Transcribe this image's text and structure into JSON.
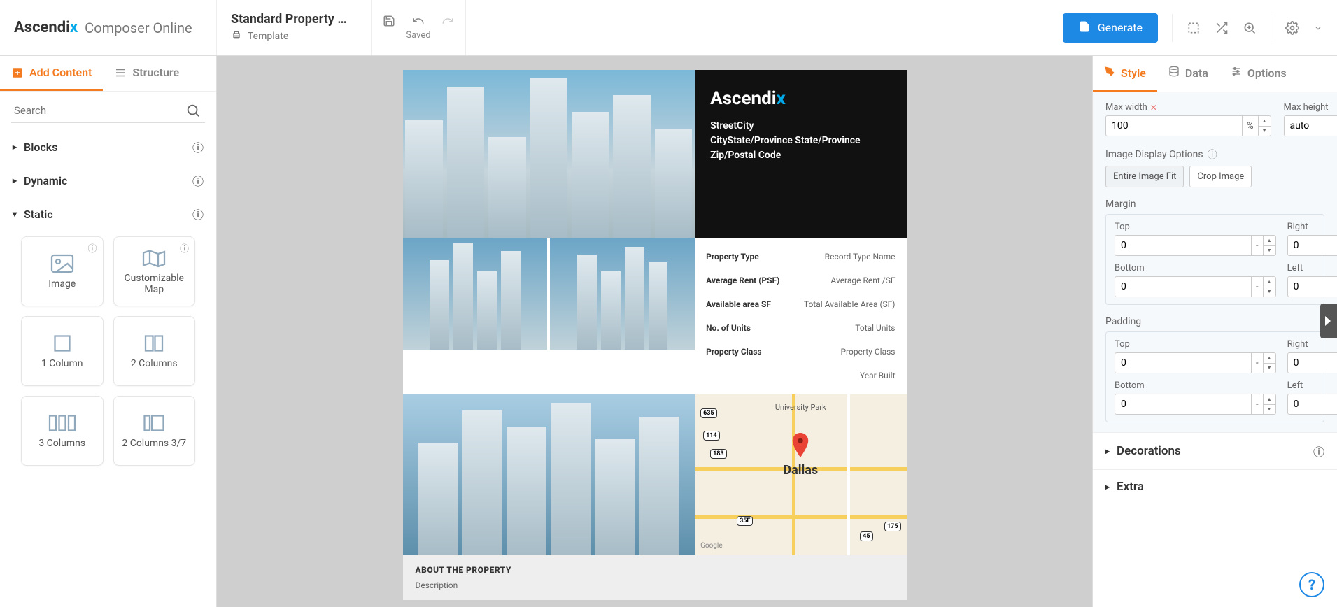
{
  "brand": {
    "name_a": "Ascendi",
    "name_x": "x",
    "app_name": "Composer Online"
  },
  "doc": {
    "title": "Standard Property Ma...",
    "sub": "Template",
    "saved": "Saved"
  },
  "topbar": {
    "generate": "Generate"
  },
  "left": {
    "tab_add": "Add Content",
    "tab_structure": "Structure",
    "search_placeholder": "Search",
    "sections": {
      "blocks": "Blocks",
      "dynamic": "Dynamic",
      "static": "Static"
    },
    "static_items": [
      "Image",
      "Customizable Map",
      "1 Column",
      "2 Columns",
      "3 Columns",
      "2 Columns 3/7"
    ]
  },
  "template": {
    "logo_a": "Ascendi",
    "logo_x": "x",
    "addr1": "StreetCity",
    "addr2": "CityState/Province State/Province",
    "addr3": "Zip/Postal Code",
    "kv": [
      {
        "k": "Property Type",
        "v": "Record Type Name"
      },
      {
        "k": "Average Rent (PSF)",
        "v": "Average Rent /SF"
      },
      {
        "k": "Available area SF",
        "v": "Total Available Area (SF)"
      },
      {
        "k": "No. of Units",
        "v": "Total Units"
      },
      {
        "k": "Property Class",
        "v": "Property Class"
      },
      {
        "k": "",
        "v": "Year Built"
      }
    ],
    "map_city": "Dallas",
    "map_label_univ": "University Park",
    "about_title": "ABOUT THE PROPERTY",
    "about_desc": "Description"
  },
  "right": {
    "tab_style": "Style",
    "tab_data": "Data",
    "tab_options": "Options",
    "max_width_label": "Max width",
    "max_width_value": "100",
    "max_width_unit": "%",
    "max_height_label": "Max height",
    "max_height_value": "auto",
    "max_height_unit": "-",
    "image_display_label": "Image Display Options",
    "entire_fit": "Entire Image Fit",
    "crop": "Crop Image",
    "margin_label": "Margin",
    "padding_label": "Padding",
    "top": "Top",
    "right_l": "Right",
    "bottom": "Bottom",
    "left_l": "Left",
    "zero": "0",
    "dash": "-",
    "decorations": "Decorations",
    "extra": "Extra"
  }
}
